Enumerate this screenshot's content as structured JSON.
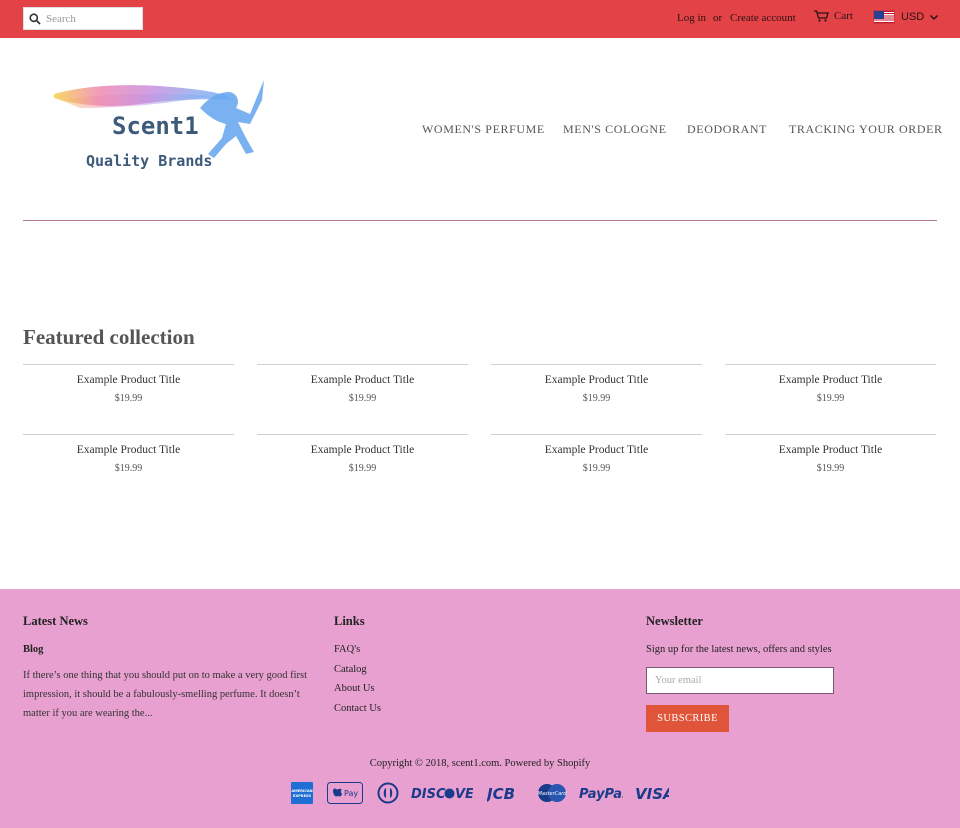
{
  "topbar": {
    "search_placeholder": "Search",
    "login": "Log in",
    "or": "or",
    "create_account": "Create account",
    "cart": "Cart",
    "currency": "USD",
    "bg_color": "#e34346"
  },
  "logo": {
    "line1": "Scent1",
    "line2": "Quality Brands"
  },
  "nav": {
    "items": [
      "WOMEN'S PERFUME",
      "MEN'S COLOGNE",
      "DEODORANT",
      "TRACKING YOUR ORDER"
    ]
  },
  "featured": {
    "title": "Featured collection",
    "products": [
      {
        "title": "Example Product Title",
        "price": "$19.99"
      },
      {
        "title": "Example Product Title",
        "price": "$19.99"
      },
      {
        "title": "Example Product Title",
        "price": "$19.99"
      },
      {
        "title": "Example Product Title",
        "price": "$19.99"
      },
      {
        "title": "Example Product Title",
        "price": "$19.99"
      },
      {
        "title": "Example Product Title",
        "price": "$19.99"
      },
      {
        "title": "Example Product Title",
        "price": "$19.99"
      },
      {
        "title": "Example Product Title",
        "price": "$19.99"
      }
    ]
  },
  "footer": {
    "bg_color": "#e8a0d0",
    "latest_news": {
      "heading": "Latest News",
      "blog_title": "Blog",
      "excerpt": "If there’s one thing that you should put on to make a very good first impression, it should be a fabulously-smelling perfume. It doesn’t matter if you are wearing the..."
    },
    "links": {
      "heading": "Links",
      "items": [
        "FAQ's",
        "Catalog",
        "About Us",
        "Contact Us"
      ]
    },
    "newsletter": {
      "heading": "Newsletter",
      "text": "Sign up for the latest news, offers and styles",
      "email_placeholder": "Your email",
      "button": "SUBSCRIBE",
      "button_color": "#e0553a"
    },
    "copyright": "Copyright © 2018, scent1.com. Powered by Shopify",
    "payments": {
      "amex": "AMERICAN EXPRESS",
      "applepay": "Pay",
      "discover": "DISCOVER",
      "jcb": "JCB",
      "mastercard": "MasterCard",
      "paypal": "PayPal",
      "visa": "VISA"
    }
  }
}
